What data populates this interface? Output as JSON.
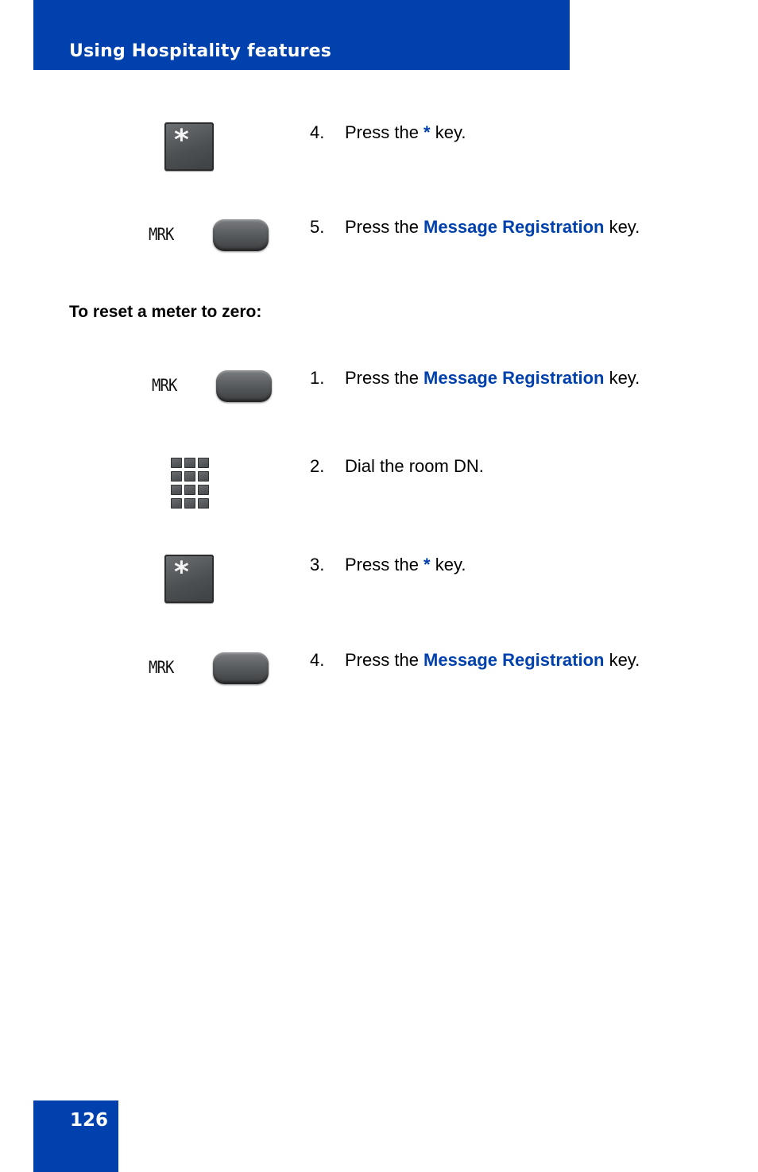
{
  "header": {
    "title": "Using Hospitality features",
    "color": "#0041ad"
  },
  "page_number": "126",
  "steps_top": [
    {
      "num": "4.",
      "pre": "Press the ",
      "key": "*",
      "post": " key.",
      "icon": "star-key"
    },
    {
      "num": "5.",
      "pre": "Press the ",
      "key": "Message Registration",
      "post": " key.",
      "icon": "mrk-key",
      "icon_label": "MRK"
    }
  ],
  "section": {
    "heading": "To reset a meter to zero:"
  },
  "steps_reset": [
    {
      "num": "1.",
      "pre": "Press the ",
      "key": "Message Registration",
      "post": " key.",
      "icon": "mrk-key",
      "icon_label": "MRK"
    },
    {
      "num": "2.",
      "pre": "Dial the room DN.",
      "key": "",
      "post": "",
      "icon": "dialpad"
    },
    {
      "num": "3.",
      "pre": "Press the ",
      "key": "*",
      "post": " key.",
      "icon": "star-key"
    },
    {
      "num": "4.",
      "pre": "Press the ",
      "key": "Message Registration",
      "post": " key.",
      "icon": "mrk-key",
      "icon_label": "MRK"
    }
  ],
  "star_glyph": "*"
}
